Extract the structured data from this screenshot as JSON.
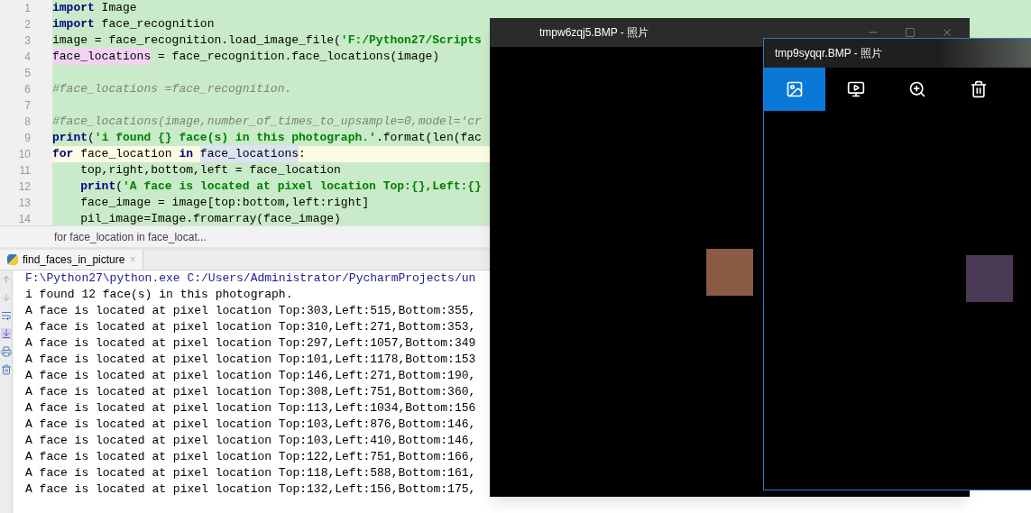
{
  "editor": {
    "lines": [
      {
        "number": "1",
        "current": false,
        "segments": [
          {
            "kind": "keyword",
            "text": "import"
          },
          {
            "kind": "plain",
            "text": " Image"
          }
        ]
      },
      {
        "number": "2",
        "current": false,
        "segments": [
          {
            "kind": "keyword",
            "text": "import"
          },
          {
            "kind": "plain",
            "text": " face_recognition"
          }
        ]
      },
      {
        "number": "3",
        "current": false,
        "segments": [
          {
            "kind": "plain",
            "text": "image = face_recognition.load_image_file("
          },
          {
            "kind": "string",
            "text": "'F:/Python27/Scripts"
          }
        ]
      },
      {
        "number": "4",
        "current": false,
        "segments": [
          {
            "kind": "usage",
            "text": "face_locations"
          },
          {
            "kind": "plain",
            "text": " = face_recognition.face_locations(image)"
          }
        ]
      },
      {
        "number": "5",
        "current": false
      },
      {
        "number": "6",
        "current": false,
        "segments": [
          {
            "kind": "comment",
            "text": "#face_locations =face_recognition."
          }
        ]
      },
      {
        "number": "7",
        "current": false
      },
      {
        "number": "8",
        "current": false,
        "segments": [
          {
            "kind": "comment",
            "text": "#face_locations(image,number_of_times_to_upsample=0,model='cr"
          }
        ]
      },
      {
        "number": "9",
        "current": false,
        "segments": [
          {
            "kind": "keyword",
            "text": "print"
          },
          {
            "kind": "plain",
            "text": "("
          },
          {
            "kind": "string",
            "text": "'i found {} face(s) in this photograph.'"
          },
          {
            "kind": "plain",
            "text": ".format(len(fac"
          }
        ]
      },
      {
        "number": "10",
        "current": true,
        "segments": [
          {
            "kind": "keyword",
            "text": "for"
          },
          {
            "kind": "plain",
            "text": " face_location "
          },
          {
            "kind": "keyword",
            "text": "in "
          },
          {
            "kind": "reference",
            "text": "face_locations"
          },
          {
            "kind": "plain",
            "text": ":"
          }
        ]
      },
      {
        "number": "11",
        "current": false,
        "segments": [
          {
            "kind": "plain",
            "text": "    top,right,bottom,left = face_location"
          }
        ]
      },
      {
        "number": "12",
        "current": false,
        "segments": [
          {
            "kind": "keyword",
            "text": "    print"
          },
          {
            "kind": "plain",
            "text": "("
          },
          {
            "kind": "string",
            "text": "'A face is located at pixel location Top:{},Left:{}"
          }
        ]
      },
      {
        "number": "13",
        "current": false,
        "segments": [
          {
            "kind": "plain",
            "text": "    face_image = image[top:bottom,left:right]"
          }
        ]
      },
      {
        "number": "14",
        "current": false,
        "segments": [
          {
            "kind": "plain",
            "text": "    pil_image=Image.fromarray(face_image)"
          }
        ]
      }
    ]
  },
  "breadcrumb": "for face_location in face_locat...",
  "run_tab": {
    "label": "find_faces_in_picture",
    "close": "×"
  },
  "console": {
    "lines": [
      {
        "kind": "command",
        "text": "F:\\Python27\\python.exe C:/Users/Administrator/PycharmProjects/un"
      },
      {
        "kind": "output",
        "text": "i found 12 face(s) in this photograph."
      },
      {
        "kind": "output",
        "text": "A face is located at pixel location Top:303,Left:515,Bottom:355,"
      },
      {
        "kind": "output",
        "text": "A face is located at pixel location Top:310,Left:271,Bottom:353,"
      },
      {
        "kind": "output",
        "text": "A face is located at pixel location Top:297,Left:1057,Bottom:349"
      },
      {
        "kind": "output",
        "text": "A face is located at pixel location Top:101,Left:1178,Bottom:153"
      },
      {
        "kind": "output",
        "text": "A face is located at pixel location Top:146,Left:271,Bottom:190,"
      },
      {
        "kind": "output",
        "text": "A face is located at pixel location Top:308,Left:751,Bottom:360,"
      },
      {
        "kind": "output",
        "text": "A face is located at pixel location Top:113,Left:1034,Bottom:156"
      },
      {
        "kind": "output",
        "text": "A face is located at pixel location Top:103,Left:876,Bottom:146,"
      },
      {
        "kind": "output",
        "text": "A face is located at pixel location Top:103,Left:410,Bottom:146,"
      },
      {
        "kind": "output",
        "text": "A face is located at pixel location Top:122,Left:751,Bottom:166,"
      },
      {
        "kind": "output",
        "text": "A face is located at pixel location Top:118,Left:588,Bottom:161,"
      },
      {
        "kind": "output",
        "text": "A face is located at pixel location Top:132,Left:156,Bottom:175,"
      }
    ]
  },
  "windows": [
    {
      "title": "tmpw6zqj5.BMP - 照片",
      "focused": false
    },
    {
      "title": "tmp9syqqr.BMP - 照片",
      "focused": true,
      "toolbar": [
        {
          "kind": "image",
          "selected": true
        },
        {
          "kind": "slideshow",
          "selected": false
        },
        {
          "kind": "zoom",
          "selected": false
        },
        {
          "kind": "delete",
          "selected": false
        }
      ]
    }
  ]
}
